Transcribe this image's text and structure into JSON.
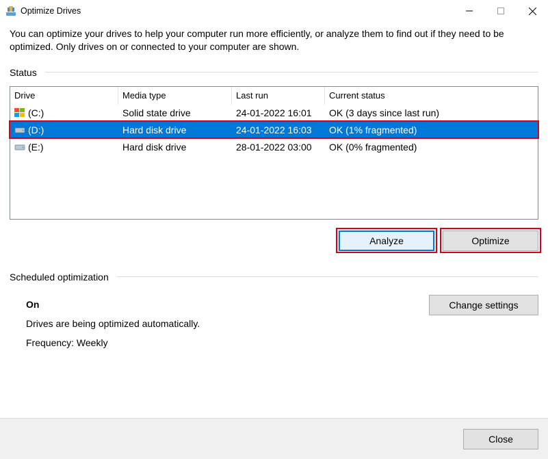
{
  "window": {
    "title": "Optimize Drives"
  },
  "intro": "You can optimize your drives to help your computer run more efficiently, or analyze them to find out if they need to be optimized. Only drives on or connected to your computer are shown.",
  "status_label": "Status",
  "columns": {
    "drive": "Drive",
    "media": "Media type",
    "last": "Last run",
    "status": "Current status"
  },
  "drives": [
    {
      "name": "(C:)",
      "media": "Solid state drive",
      "last": "24-01-2022 16:01",
      "status": "OK (3 days since last run)",
      "selected": false,
      "icon": "windows"
    },
    {
      "name": "(D:)",
      "media": "Hard disk drive",
      "last": "24-01-2022 16:03",
      "status": "OK (1% fragmented)",
      "selected": true,
      "icon": "hdd"
    },
    {
      "name": "(E:)",
      "media": "Hard disk drive",
      "last": "28-01-2022 03:00",
      "status": "OK (0% fragmented)",
      "selected": false,
      "icon": "hdd"
    }
  ],
  "buttons": {
    "analyze": "Analyze",
    "optimize": "Optimize",
    "change_settings": "Change settings",
    "close": "Close"
  },
  "scheduled": {
    "label": "Scheduled optimization",
    "on": "On",
    "auto": "Drives are being optimized automatically.",
    "freq": "Frequency: Weekly"
  }
}
